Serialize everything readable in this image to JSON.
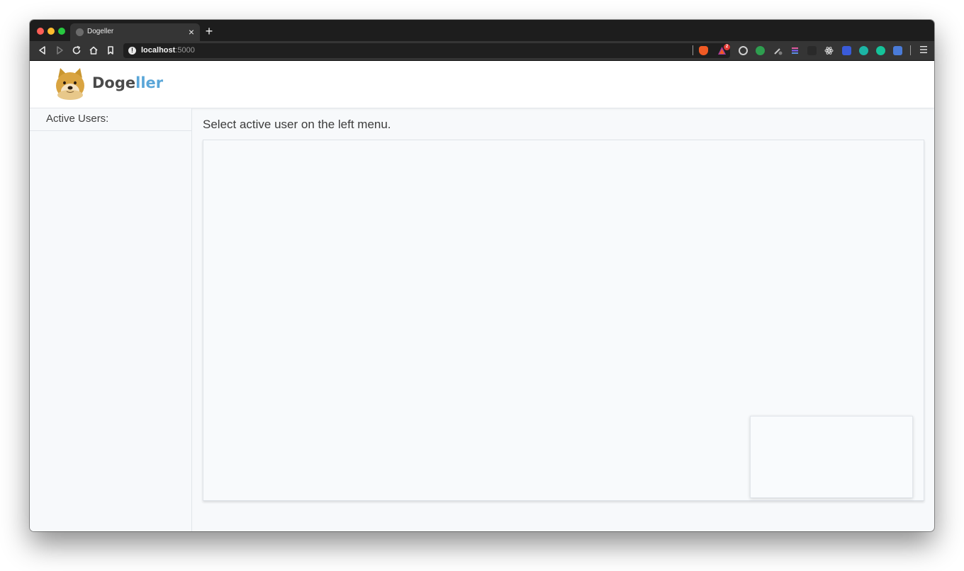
{
  "browser": {
    "tab_title": "Dogeller",
    "tab_close": "×",
    "new_tab": "+",
    "url_host": "localhost",
    "url_port": ":5000",
    "ext_badge": "2"
  },
  "app": {
    "brand_part1": "Doge",
    "brand_part2": "ller",
    "sidebar_title": "Active Users:",
    "hint": "Select active user on the left menu."
  },
  "colors": {
    "brand_dark": "#4a4a4a",
    "brand_accent": "#5aa6d8",
    "page_bg": "#f7f9fb"
  }
}
